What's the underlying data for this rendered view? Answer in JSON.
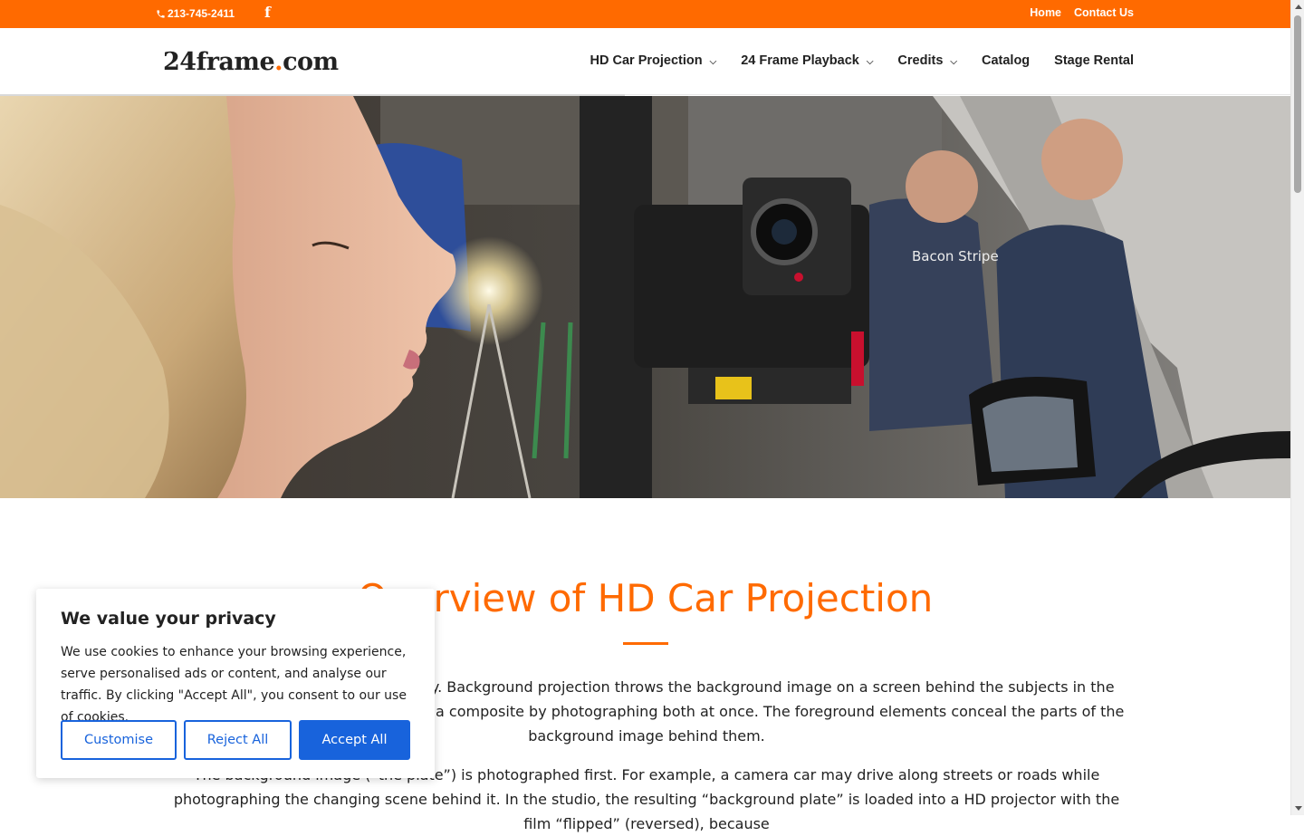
{
  "topbar": {
    "phone": "213-745-2411",
    "facebook_glyph": "f",
    "links": [
      "Home",
      "Contact Us"
    ]
  },
  "header": {
    "logo_main": "24frame",
    "logo_dot": ".",
    "logo_tld": "com",
    "nav": [
      {
        "label": "HD Car Projection",
        "has_dropdown": true
      },
      {
        "label": "24 Frame Playback",
        "has_dropdown": true
      },
      {
        "label": "Credits",
        "has_dropdown": true
      },
      {
        "label": "Catalog",
        "has_dropdown": false
      },
      {
        "label": "Stage Rental",
        "has_dropdown": false
      }
    ]
  },
  "hero": {
    "sign_text": "Bacon Stripe"
  },
  "main": {
    "title": "Overview of HD Car Projection",
    "paragraph1": "Rear projection is an old technology. Background projection throws the background image on a screen behind the subjects in the foreground while the camera makes a composite by photographing both at once. The foreground elements conceal the parts of the background image behind them.",
    "paragraph2": "The background image (“the plate”) is photographed first. For example, a camera car may drive along streets or roads while photographing the changing scene behind it. In the studio, the resulting “background plate” is loaded into a HD projector with the film “flipped” (reversed), because"
  },
  "cookie": {
    "title": "We value your privacy",
    "body": "We use cookies to enhance your browsing experience, serve personalised ads or content, and analyse our traffic. By clicking \"Accept All\", you consent to our use of cookies.",
    "customise": "Customise",
    "reject": "Reject All",
    "accept": "Accept All"
  },
  "colors": {
    "accent": "#ff6a00",
    "button_blue": "#1863dc"
  }
}
